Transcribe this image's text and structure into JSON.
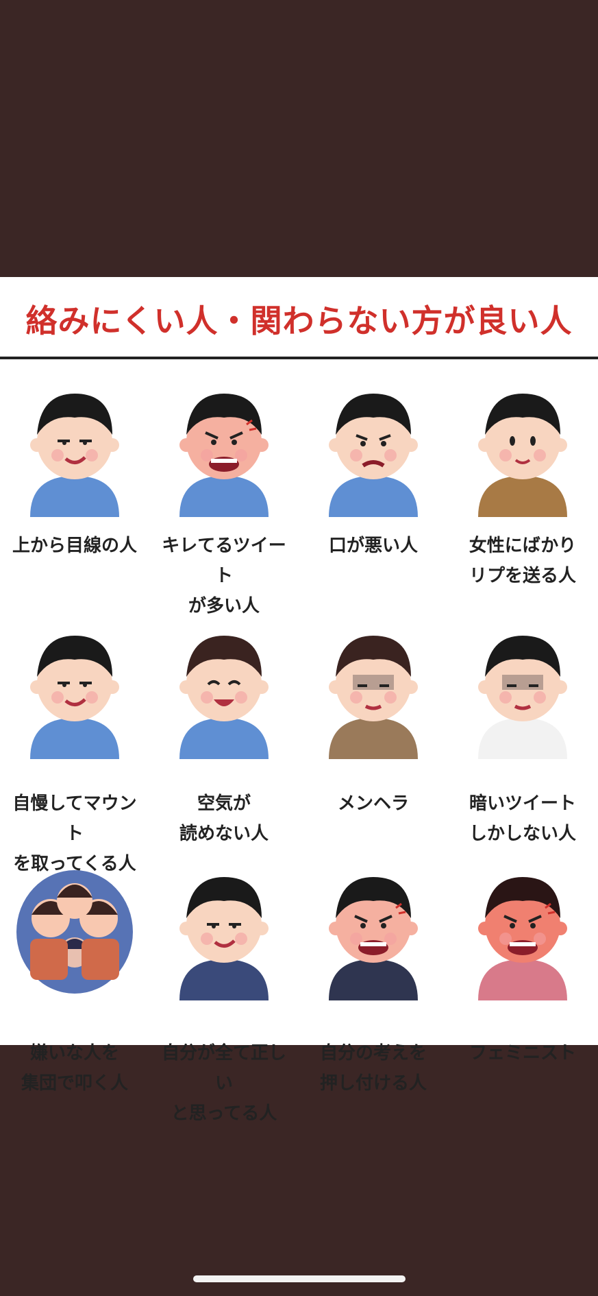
{
  "title": "絡みにくい人・関わらない方が良い人",
  "colors": {
    "background": "#3b2625",
    "title": "#d0302b",
    "card": "#ffffff"
  },
  "items": [
    {
      "caption": "上から目線の人",
      "shirt": "#5f8fd3",
      "hair": "#1a1a1a",
      "mood": "smug"
    },
    {
      "caption": "キレてるツイート\nが多い人",
      "shirt": "#5f8fd3",
      "hair": "#1a1a1a",
      "mood": "angry"
    },
    {
      "caption": "口が悪い人",
      "shirt": "#5f8fd3",
      "hair": "#1a1a1a",
      "mood": "grumpy"
    },
    {
      "caption": "女性にばかり\nリプを送る人",
      "shirt": "#a87a45",
      "hair": "#1a1a1a",
      "mood": "neutral"
    },
    {
      "caption": "自慢してマウント\nを取ってくる人",
      "shirt": "#5f8fd3",
      "hair": "#1a1a1a",
      "mood": "smug"
    },
    {
      "caption": "空気が\n読めない人",
      "shirt": "#5f8fd3",
      "hair": "#3a2320",
      "mood": "happy"
    },
    {
      "caption": "メンヘラ",
      "shirt": "#9a7a5a",
      "hair": "#3a2320",
      "mood": "gloomy"
    },
    {
      "caption": "暗いツイート\nしかしない人",
      "shirt": "#f2f2f2",
      "hair": "#1a1a1a",
      "mood": "gloomy"
    },
    {
      "caption": "嫌いな人を\n集団で叩く人",
      "shirt": "#d06a4a",
      "hair": "#3a2320",
      "mood": "group"
    },
    {
      "caption": "自分が全て正しい\nと思ってる人",
      "shirt": "#3a4a7a",
      "hair": "#1a1a1a",
      "mood": "smug"
    },
    {
      "caption": "自分の考えを\n押し付ける人",
      "shirt": "#2f3550",
      "hair": "#1a1a1a",
      "mood": "angry"
    },
    {
      "caption": "フェミニスト",
      "shirt": "#d87a8a",
      "hair": "#2a1515",
      "mood": "furious"
    }
  ]
}
